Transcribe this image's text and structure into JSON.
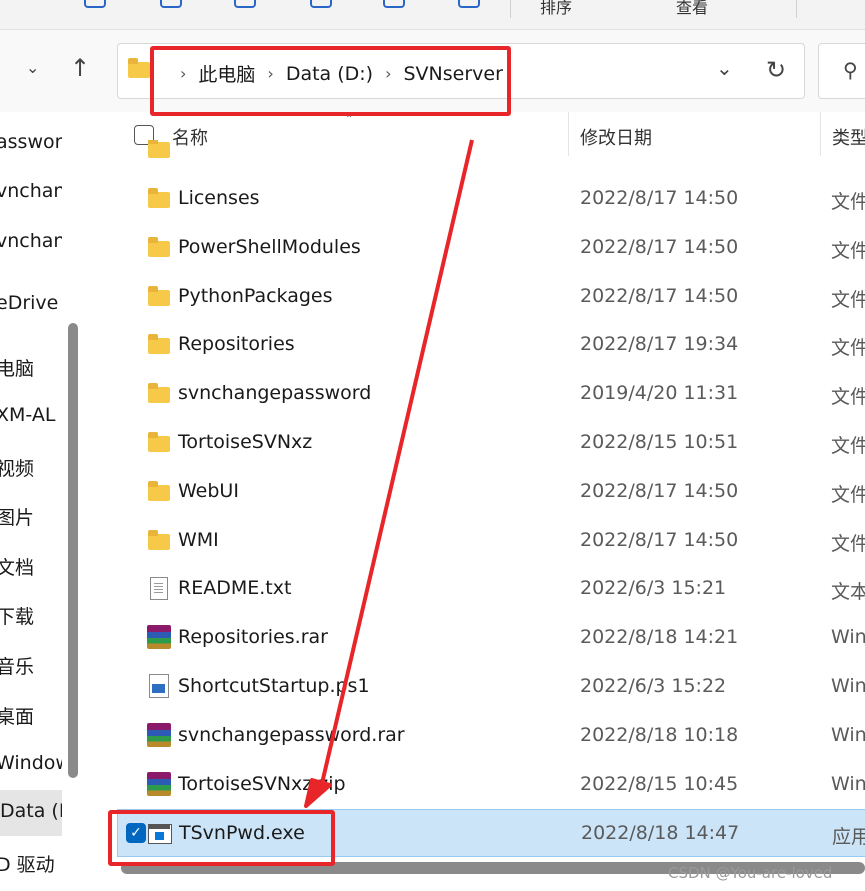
{
  "toolbar": {
    "partial_labels": [
      "排序",
      "查看"
    ]
  },
  "breadcrumb": {
    "items": [
      "此电脑",
      "Data (D:)",
      "SVNserver"
    ]
  },
  "columns": {
    "name": "名称",
    "date": "修改日期",
    "type": "类型"
  },
  "left_nav": {
    "items": [
      {
        "label": "asswor"
      },
      {
        "label": "vnchan"
      },
      {
        "label": "vnchan"
      },
      {
        "label": "eDrive"
      },
      {
        "label": "电脑"
      },
      {
        "label": "XM-AL"
      },
      {
        "label": "视频"
      },
      {
        "label": "图片"
      },
      {
        "label": "文档"
      },
      {
        "label": "下载"
      },
      {
        "label": "音乐"
      },
      {
        "label": "桌面"
      },
      {
        "label": "Window"
      },
      {
        "label": "Data (D:"
      },
      {
        "label": "D 驱动"
      }
    ]
  },
  "files": [
    {
      "icon": "folder-icon",
      "name": "Licenses",
      "date": "2022/8/17 14:50",
      "type": "文件"
    },
    {
      "icon": "folder-icon",
      "name": "PowerShellModules",
      "date": "2022/8/17 14:50",
      "type": "文件"
    },
    {
      "icon": "folder-icon",
      "name": "PythonPackages",
      "date": "2022/8/17 14:50",
      "type": "文件"
    },
    {
      "icon": "folder-icon",
      "name": "Repositories",
      "date": "2022/8/17 19:34",
      "type": "文件"
    },
    {
      "icon": "folder-icon",
      "name": "svnchangepassword",
      "date": "2019/4/20 11:31",
      "type": "文件"
    },
    {
      "icon": "folder-icon",
      "name": "TortoiseSVNxz",
      "date": "2022/8/15 10:51",
      "type": "文件"
    },
    {
      "icon": "folder-icon",
      "name": "WebUI",
      "date": "2022/8/17 14:50",
      "type": "文件"
    },
    {
      "icon": "folder-icon",
      "name": "WMI",
      "date": "2022/8/17 14:50",
      "type": "文件"
    },
    {
      "icon": "text-file-icon",
      "name": "README.txt",
      "date": "2022/6/3 15:21",
      "type": "文本"
    },
    {
      "icon": "rar-archive-icon",
      "name": "Repositories.rar",
      "date": "2022/8/18 14:21",
      "type": "Win"
    },
    {
      "icon": "powershell-script-icon",
      "name": "ShortcutStartup.ps1",
      "date": "2022/6/3 15:22",
      "type": "Win"
    },
    {
      "icon": "rar-archive-icon",
      "name": "svnchangepassword.rar",
      "date": "2022/8/18 10:18",
      "type": "Win"
    },
    {
      "icon": "rar-archive-icon",
      "name": "TortoiseSVNxz.zip",
      "date": "2022/8/15 10:45",
      "type": "Win"
    },
    {
      "icon": "exe-app-icon",
      "name": "TSvnPwd.exe",
      "date": "2022/8/18 14:47",
      "type": "应用",
      "selected": true
    }
  ],
  "watermark": "CSDN @You-are-loved",
  "colors": {
    "annotation": "#e8262a",
    "selection": "#cce4f7",
    "folder": "#f7c948",
    "accent": "#0067c0"
  }
}
